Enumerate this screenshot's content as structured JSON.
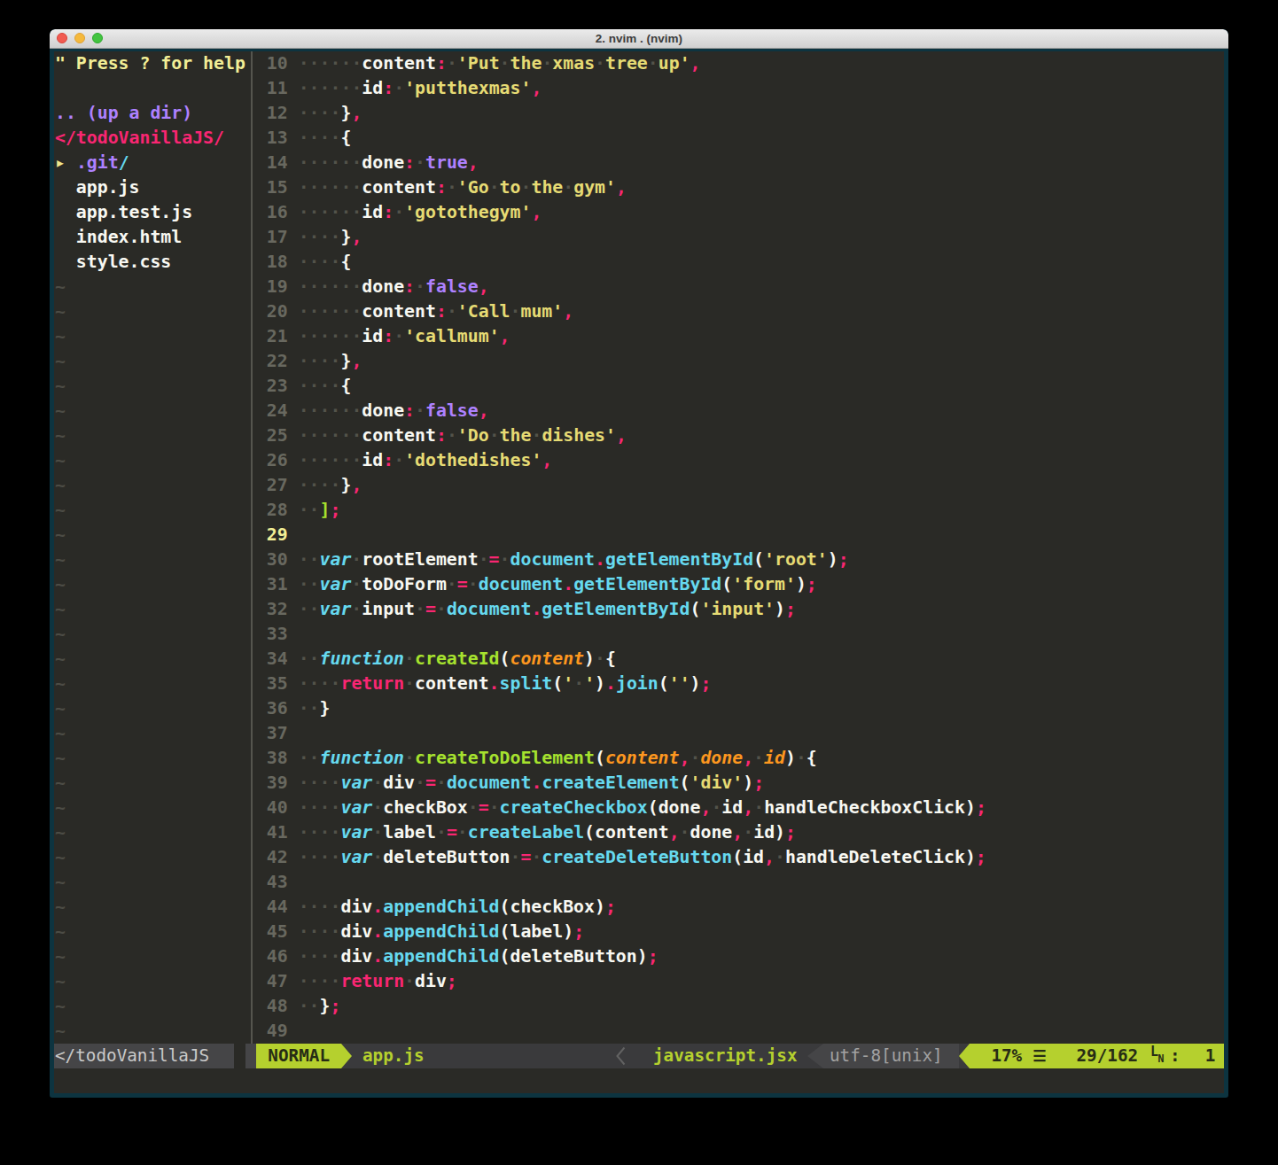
{
  "window": {
    "title": "2. nvim . (nvim)",
    "traffic_lights": [
      "close",
      "minimize",
      "zoom"
    ]
  },
  "colors": {
    "terminal_background": "#2a2a26",
    "window_border": "#0e3844",
    "statusline_accent_green": "#b5d02e",
    "syntax_pink": "#f92672",
    "syntax_cyan": "#66d9ef",
    "syntax_green": "#a6e22e",
    "syntax_orange": "#fd971f",
    "syntax_yellow": "#e6db74",
    "syntax_purple": "#ae81ff"
  },
  "sidebar": {
    "rows": [
      {
        "tokens": [
          [
            "help",
            "\" Press ? for help"
          ]
        ]
      },
      {
        "tokens": []
      },
      {
        "tokens": [
          [
            "dirup",
            ".. (up a dir)"
          ]
        ]
      },
      {
        "tokens": [
          [
            "root",
            "</todoVanillaJS/"
          ]
        ]
      },
      {
        "tokens": [
          [
            "arrow",
            "▸ "
          ],
          [
            "dir",
            ".git"
          ],
          [
            "slash",
            "/"
          ]
        ]
      },
      {
        "tokens": [
          [
            "file",
            "  app.js"
          ]
        ]
      },
      {
        "tokens": [
          [
            "file",
            "  app.test.js"
          ]
        ]
      },
      {
        "tokens": [
          [
            "file",
            "  index.html"
          ]
        ]
      },
      {
        "tokens": [
          [
            "file",
            "  style.css"
          ]
        ]
      }
    ],
    "tilde": "~",
    "tilde_rows": 31
  },
  "editor": {
    "cursor_line": "29",
    "lines": [
      {
        "n": "10",
        "tokens": [
          [
            "plain",
            "      content"
          ],
          [
            "op",
            ":"
          ],
          [
            "plain",
            " "
          ],
          [
            "str",
            "'Put the xmas tree up'"
          ],
          [
            "op",
            ","
          ]
        ]
      },
      {
        "n": "11",
        "tokens": [
          [
            "plain",
            "      id"
          ],
          [
            "op",
            ":"
          ],
          [
            "plain",
            " "
          ],
          [
            "str",
            "'putthexmas'"
          ],
          [
            "op",
            ","
          ]
        ]
      },
      {
        "n": "12",
        "tokens": [
          [
            "plain",
            "    }"
          ],
          [
            "op",
            ","
          ]
        ]
      },
      {
        "n": "13",
        "tokens": [
          [
            "plain",
            "    {"
          ]
        ]
      },
      {
        "n": "14",
        "tokens": [
          [
            "plain",
            "      done"
          ],
          [
            "op",
            ":"
          ],
          [
            "plain",
            " "
          ],
          [
            "bool",
            "true"
          ],
          [
            "op",
            ","
          ]
        ]
      },
      {
        "n": "15",
        "tokens": [
          [
            "plain",
            "      content"
          ],
          [
            "op",
            ":"
          ],
          [
            "plain",
            " "
          ],
          [
            "str",
            "'Go to the gym'"
          ],
          [
            "op",
            ","
          ]
        ]
      },
      {
        "n": "16",
        "tokens": [
          [
            "plain",
            "      id"
          ],
          [
            "op",
            ":"
          ],
          [
            "plain",
            " "
          ],
          [
            "str",
            "'gotothegym'"
          ],
          [
            "op",
            ","
          ]
        ]
      },
      {
        "n": "17",
        "tokens": [
          [
            "plain",
            "    }"
          ],
          [
            "op",
            ","
          ]
        ]
      },
      {
        "n": "18",
        "tokens": [
          [
            "plain",
            "    {"
          ]
        ]
      },
      {
        "n": "19",
        "tokens": [
          [
            "plain",
            "      done"
          ],
          [
            "op",
            ":"
          ],
          [
            "plain",
            " "
          ],
          [
            "bool",
            "false"
          ],
          [
            "op",
            ","
          ]
        ]
      },
      {
        "n": "20",
        "tokens": [
          [
            "plain",
            "      content"
          ],
          [
            "op",
            ":"
          ],
          [
            "plain",
            " "
          ],
          [
            "str",
            "'Call mum'"
          ],
          [
            "op",
            ","
          ]
        ]
      },
      {
        "n": "21",
        "tokens": [
          [
            "plain",
            "      id"
          ],
          [
            "op",
            ":"
          ],
          [
            "plain",
            " "
          ],
          [
            "str",
            "'callmum'"
          ],
          [
            "op",
            ","
          ]
        ]
      },
      {
        "n": "22",
        "tokens": [
          [
            "plain",
            "    }"
          ],
          [
            "op",
            ","
          ]
        ]
      },
      {
        "n": "23",
        "tokens": [
          [
            "plain",
            "    {"
          ]
        ]
      },
      {
        "n": "24",
        "tokens": [
          [
            "plain",
            "      done"
          ],
          [
            "op",
            ":"
          ],
          [
            "plain",
            " "
          ],
          [
            "bool",
            "false"
          ],
          [
            "op",
            ","
          ]
        ]
      },
      {
        "n": "25",
        "tokens": [
          [
            "plain",
            "      content"
          ],
          [
            "op",
            ":"
          ],
          [
            "plain",
            " "
          ],
          [
            "str",
            "'Do the dishes'"
          ],
          [
            "op",
            ","
          ]
        ]
      },
      {
        "n": "26",
        "tokens": [
          [
            "plain",
            "      id"
          ],
          [
            "op",
            ":"
          ],
          [
            "plain",
            " "
          ],
          [
            "str",
            "'dothedishes'"
          ],
          [
            "op",
            ","
          ]
        ]
      },
      {
        "n": "27",
        "tokens": [
          [
            "plain",
            "    }"
          ],
          [
            "op",
            ","
          ]
        ]
      },
      {
        "n": "28",
        "tokens": [
          [
            "plain",
            "  "
          ],
          [
            "grn",
            "]"
          ],
          [
            "op",
            ";"
          ]
        ]
      },
      {
        "n": "29",
        "tokens": []
      },
      {
        "n": "30",
        "tokens": [
          [
            "plain",
            "  "
          ],
          [
            "kw",
            "var"
          ],
          [
            "plain",
            " rootElement "
          ],
          [
            "op",
            "="
          ],
          [
            "plain",
            " "
          ],
          [
            "fn",
            "document"
          ],
          [
            "op",
            "."
          ],
          [
            "fn",
            "getElementById"
          ],
          [
            "plain",
            "("
          ],
          [
            "str",
            "'root'"
          ],
          [
            "plain",
            ")"
          ],
          [
            "op",
            ";"
          ]
        ]
      },
      {
        "n": "31",
        "tokens": [
          [
            "plain",
            "  "
          ],
          [
            "kw",
            "var"
          ],
          [
            "plain",
            " toDoForm "
          ],
          [
            "op",
            "="
          ],
          [
            "plain",
            " "
          ],
          [
            "fn",
            "document"
          ],
          [
            "op",
            "."
          ],
          [
            "fn",
            "getElementById"
          ],
          [
            "plain",
            "("
          ],
          [
            "str",
            "'form'"
          ],
          [
            "plain",
            ")"
          ],
          [
            "op",
            ";"
          ]
        ]
      },
      {
        "n": "32",
        "tokens": [
          [
            "plain",
            "  "
          ],
          [
            "kw",
            "var"
          ],
          [
            "plain",
            " input "
          ],
          [
            "op",
            "="
          ],
          [
            "plain",
            " "
          ],
          [
            "fn",
            "document"
          ],
          [
            "op",
            "."
          ],
          [
            "fn",
            "getElementById"
          ],
          [
            "plain",
            "("
          ],
          [
            "str",
            "'input'"
          ],
          [
            "plain",
            ")"
          ],
          [
            "op",
            ";"
          ]
        ]
      },
      {
        "n": "33",
        "tokens": []
      },
      {
        "n": "34",
        "tokens": [
          [
            "plain",
            "  "
          ],
          [
            "kw",
            "function"
          ],
          [
            "plain",
            " "
          ],
          [
            "def",
            "createId"
          ],
          [
            "plain",
            "("
          ],
          [
            "param",
            "content"
          ],
          [
            "plain",
            ") {"
          ]
        ]
      },
      {
        "n": "35",
        "tokens": [
          [
            "plain",
            "    "
          ],
          [
            "op",
            "return"
          ],
          [
            "plain",
            " content"
          ],
          [
            "op",
            "."
          ],
          [
            "fn",
            "split"
          ],
          [
            "plain",
            "("
          ],
          [
            "str",
            "' '"
          ],
          [
            "plain",
            ")"
          ],
          [
            "op",
            "."
          ],
          [
            "fn",
            "join"
          ],
          [
            "plain",
            "("
          ],
          [
            "str",
            "''"
          ],
          [
            "plain",
            ")"
          ],
          [
            "op",
            ";"
          ]
        ]
      },
      {
        "n": "36",
        "tokens": [
          [
            "plain",
            "  }"
          ]
        ]
      },
      {
        "n": "37",
        "tokens": []
      },
      {
        "n": "38",
        "tokens": [
          [
            "plain",
            "  "
          ],
          [
            "kw",
            "function"
          ],
          [
            "plain",
            " "
          ],
          [
            "def",
            "createToDoElement"
          ],
          [
            "plain",
            "("
          ],
          [
            "param",
            "content"
          ],
          [
            "op",
            ","
          ],
          [
            "plain",
            " "
          ],
          [
            "param",
            "done"
          ],
          [
            "op",
            ","
          ],
          [
            "plain",
            " "
          ],
          [
            "param",
            "id"
          ],
          [
            "plain",
            ") {"
          ]
        ]
      },
      {
        "n": "39",
        "tokens": [
          [
            "plain",
            "    "
          ],
          [
            "kw",
            "var"
          ],
          [
            "plain",
            " div "
          ],
          [
            "op",
            "="
          ],
          [
            "plain",
            " "
          ],
          [
            "fn",
            "document"
          ],
          [
            "op",
            "."
          ],
          [
            "fn",
            "createElement"
          ],
          [
            "plain",
            "("
          ],
          [
            "str",
            "'div'"
          ],
          [
            "plain",
            ")"
          ],
          [
            "op",
            ";"
          ]
        ]
      },
      {
        "n": "40",
        "tokens": [
          [
            "plain",
            "    "
          ],
          [
            "kw",
            "var"
          ],
          [
            "plain",
            " checkBox "
          ],
          [
            "op",
            "="
          ],
          [
            "plain",
            " "
          ],
          [
            "fn",
            "createCheckbox"
          ],
          [
            "plain",
            "(done"
          ],
          [
            "op",
            ","
          ],
          [
            "plain",
            " id"
          ],
          [
            "op",
            ","
          ],
          [
            "plain",
            " handleCheckboxClick)"
          ],
          [
            "op",
            ";"
          ]
        ]
      },
      {
        "n": "41",
        "tokens": [
          [
            "plain",
            "    "
          ],
          [
            "kw",
            "var"
          ],
          [
            "plain",
            " label "
          ],
          [
            "op",
            "="
          ],
          [
            "plain",
            " "
          ],
          [
            "fn",
            "createLabel"
          ],
          [
            "plain",
            "(content"
          ],
          [
            "op",
            ","
          ],
          [
            "plain",
            " done"
          ],
          [
            "op",
            ","
          ],
          [
            "plain",
            " id)"
          ],
          [
            "op",
            ";"
          ]
        ]
      },
      {
        "n": "42",
        "tokens": [
          [
            "plain",
            "    "
          ],
          [
            "kw",
            "var"
          ],
          [
            "plain",
            " deleteButton "
          ],
          [
            "op",
            "="
          ],
          [
            "plain",
            " "
          ],
          [
            "fn",
            "createDeleteButton"
          ],
          [
            "plain",
            "(id"
          ],
          [
            "op",
            ","
          ],
          [
            "plain",
            " handleDeleteClick)"
          ],
          [
            "op",
            ";"
          ]
        ]
      },
      {
        "n": "43",
        "tokens": []
      },
      {
        "n": "44",
        "tokens": [
          [
            "plain",
            "    div"
          ],
          [
            "op",
            "."
          ],
          [
            "fn",
            "appendChild"
          ],
          [
            "plain",
            "(checkBox)"
          ],
          [
            "op",
            ";"
          ]
        ]
      },
      {
        "n": "45",
        "tokens": [
          [
            "plain",
            "    div"
          ],
          [
            "op",
            "."
          ],
          [
            "fn",
            "appendChild"
          ],
          [
            "plain",
            "(label)"
          ],
          [
            "op",
            ";"
          ]
        ]
      },
      {
        "n": "46",
        "tokens": [
          [
            "plain",
            "    div"
          ],
          [
            "op",
            "."
          ],
          [
            "fn",
            "appendChild"
          ],
          [
            "plain",
            "(deleteButton)"
          ],
          [
            "op",
            ";"
          ]
        ]
      },
      {
        "n": "47",
        "tokens": [
          [
            "plain",
            "    "
          ],
          [
            "op",
            "return"
          ],
          [
            "plain",
            " div"
          ],
          [
            "op",
            ";"
          ]
        ]
      },
      {
        "n": "48",
        "tokens": [
          [
            "plain",
            "  }"
          ],
          [
            "op",
            ";"
          ]
        ]
      },
      {
        "n": "49",
        "tokens": []
      }
    ]
  },
  "statusline": {
    "nerdtree_file": "</todoVanillaJS",
    "mode": "NORMAL",
    "file": "app.js",
    "filetype": "javascript.jsx",
    "encoding": "utf-8[unix]",
    "percent": "17%",
    "lines_icon": "☰",
    "position": "29/162",
    "colon": ":",
    "column": "1"
  }
}
